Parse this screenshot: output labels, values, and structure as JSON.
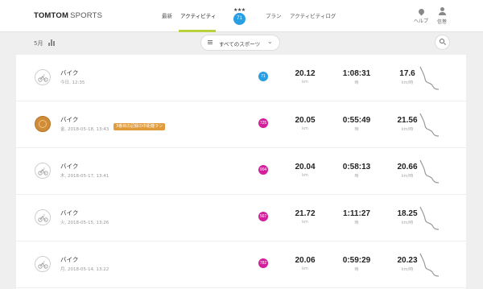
{
  "header": {
    "logo_brand": "TOMTOM",
    "logo_product": "SPORTS",
    "nav": [
      {
        "label": "最新"
      },
      {
        "label": "アクティビティ"
      },
      {
        "label": "プラン"
      },
      {
        "label": "アクティビティログ"
      }
    ],
    "level_badge": {
      "stars": "★★★",
      "value": "71"
    },
    "help_label": "ヘルプ",
    "settings_label": "信巻"
  },
  "filter": {
    "month_label": "5月",
    "sport_selector": "すべてのスポーツ"
  },
  "colors": {
    "accent": "#b7d23c",
    "level": "#2a9ee2",
    "score": "#d41f9d",
    "medal": "#cf8d3a"
  },
  "activities": [
    {
      "title": "バイク",
      "date": "今日, 12:35",
      "score": "71",
      "score_color": "#2a9ee2",
      "tag": "",
      "icon": "bike-icon",
      "distance": "20.12",
      "distance_unit": "km",
      "duration": "1:08:31",
      "duration_unit": "時",
      "speed": "17.6",
      "speed_unit": "km/時"
    },
    {
      "title": "バイク",
      "date": "金, 2018-05-18, 13:43",
      "score": "725",
      "score_color": "#d41f9d",
      "tag": "3番目の記録の中距離ラン",
      "icon": "medal-icon",
      "distance": "20.05",
      "distance_unit": "km",
      "duration": "0:55:49",
      "duration_unit": "時",
      "speed": "21.56",
      "speed_unit": "km/時"
    },
    {
      "title": "バイク",
      "date": "木, 2018-05-17, 13:41",
      "score": "904",
      "score_color": "#d41f9d",
      "tag": "",
      "icon": "bike-icon",
      "distance": "20.04",
      "distance_unit": "km",
      "duration": "0:58:13",
      "duration_unit": "時",
      "speed": "20.66",
      "speed_unit": "km/時"
    },
    {
      "title": "バイク",
      "date": "火, 2018-05-15, 13:26",
      "score": "567",
      "score_color": "#d41f9d",
      "tag": "",
      "icon": "bike-icon",
      "distance": "21.72",
      "distance_unit": "km",
      "duration": "1:11:27",
      "duration_unit": "時",
      "speed": "18.25",
      "speed_unit": "km/時"
    },
    {
      "title": "バイク",
      "date": "月, 2018-05-14, 13:22",
      "score": "782",
      "score_color": "#d41f9d",
      "tag": "",
      "icon": "bike-icon",
      "distance": "20.06",
      "distance_unit": "km",
      "duration": "0:59:29",
      "duration_unit": "時",
      "speed": "20.23",
      "speed_unit": "km/時"
    }
  ]
}
